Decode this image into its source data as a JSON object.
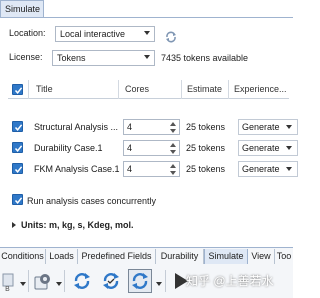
{
  "window": {
    "tab_title": "Simulate"
  },
  "form": {
    "location_label": "Location:",
    "location_value": "Local interactive",
    "license_label": "License:",
    "license_value": "Tokens",
    "tokens_available": "7435 tokens available"
  },
  "grid": {
    "columns": [
      "Title",
      "Cores",
      "Estimate",
      "Experience..."
    ],
    "rows": [
      {
        "title": "Structural Analysis ...",
        "cores": "4",
        "estimate": "25 tokens",
        "experience": "Generate"
      },
      {
        "title": "Durability Case.1",
        "cores": "4",
        "estimate": "25 tokens",
        "experience": "Generate"
      },
      {
        "title": "FKM Analysis Case.1",
        "cores": "4",
        "estimate": "25 tokens",
        "experience": "Generate"
      }
    ]
  },
  "options": {
    "concurrent_label": "Run analysis cases concurrently",
    "units_label": "Units: m, kg, s, Kdeg, mol."
  },
  "tabs": [
    "Conditions",
    "Loads",
    "Predefined Fields",
    "Durability",
    "Simulate",
    "View",
    "Too"
  ],
  "active_tab": "Simulate",
  "watermark": "知乎 @上善若水",
  "colors": {
    "accent": "#2f78c8",
    "tab_active": "#dfe8f5"
  },
  "icons": [
    "refresh-icon",
    "check-icon",
    "settings-gear-icon",
    "sync-icon",
    "play-icon"
  ]
}
